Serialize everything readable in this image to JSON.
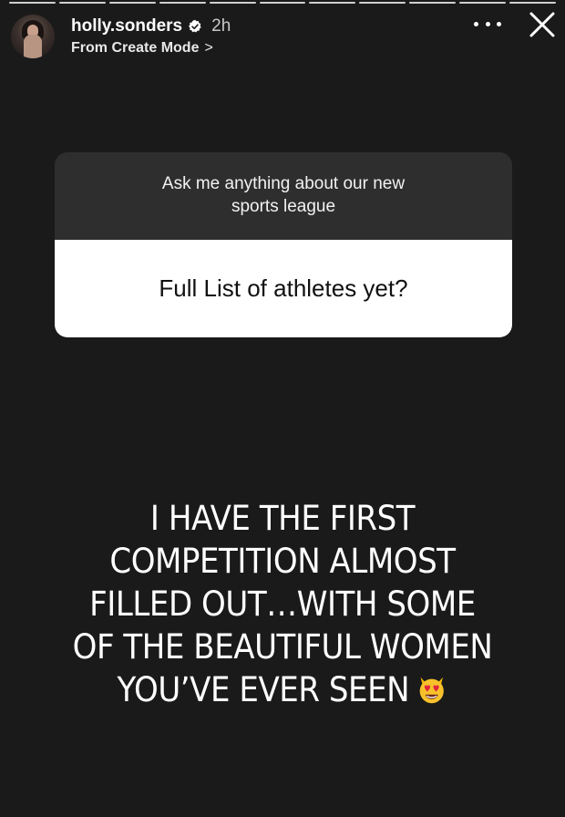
{
  "header": {
    "username": "holly.sonders",
    "time_ago": "2h",
    "subtitle": "From Create Mode",
    "subtitle_chevron": ">",
    "verified": true,
    "avatar_icon": "profile-photo"
  },
  "progress": {
    "segments": 11,
    "color": "#cfcfcf"
  },
  "controls": {
    "more_icon": "more-dots-icon",
    "close_icon": "close-icon"
  },
  "question_sticker": {
    "prompt": "Ask me anything about our new sports league",
    "answer": "Full List of athletes yet?",
    "prompt_bg": "#2e2e2e",
    "answer_bg": "#ffffff"
  },
  "caption": {
    "line1": "I HAVE THE FIRST",
    "line2": "COMPETITION ALMOST",
    "line3": "FILLED OUT…WITH SOME",
    "line4": "OF THE BEAUTIFUL WOMEN",
    "line5": "YOU’VE EVER SEEN",
    "emoji": "heart-eyes-cat-emoji"
  },
  "colors": {
    "background": "#1a1a1a",
    "text": "#ffffff",
    "verified_badge": "#ffffff"
  }
}
